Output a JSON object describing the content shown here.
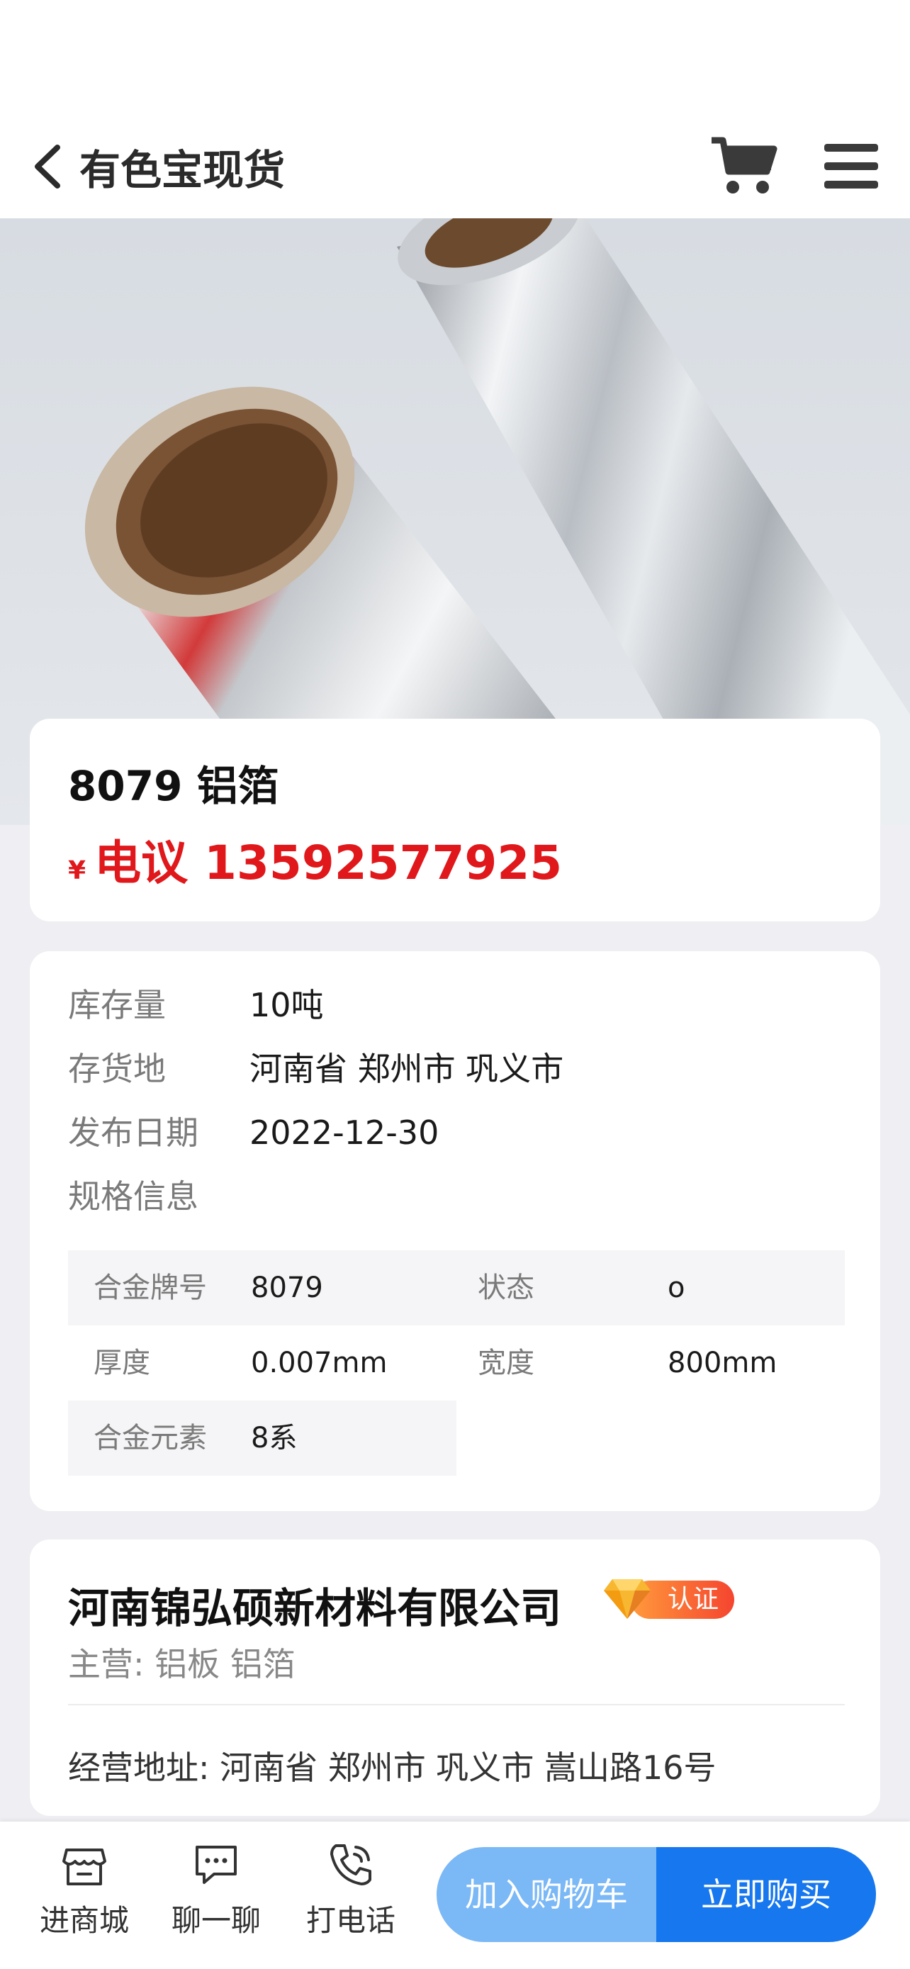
{
  "header": {
    "title": "有色宝现货",
    "back_icon": "chevron-left-icon",
    "cart_icon": "cart-icon",
    "menu_icon": "hamburger-menu-icon"
  },
  "hero": {
    "image": "aluminum-foil-rolls"
  },
  "product": {
    "name": "8079 铝箔",
    "price_symbol": "¥",
    "price_text": "电议 13592577925",
    "price_color": "#e0181b"
  },
  "info": {
    "rows": [
      {
        "label": "库存量",
        "value": "10吨"
      },
      {
        "label": "存货地",
        "value": "河南省 郑州市 巩义市"
      },
      {
        "label": "发布日期",
        "value": "2022-12-30"
      },
      {
        "label": "规格信息",
        "value": ""
      }
    ],
    "specs": [
      {
        "label": "合金牌号",
        "value": "8079"
      },
      {
        "label": "状态",
        "value": "o"
      },
      {
        "label": "厚度",
        "value": "0.007mm"
      },
      {
        "label": "宽度",
        "value": "800mm"
      },
      {
        "label": "合金元素",
        "value": "8系"
      }
    ]
  },
  "company": {
    "name": "河南锦弘硕新材料有限公司",
    "cert_label": "认证",
    "main_business": "主营: 铝板   铝箔",
    "address": "经营地址: 河南省 郑州市 巩义市 嵩山路16号"
  },
  "bottom_bar": {
    "tabs": [
      {
        "icon": "store-icon",
        "label": "进商城"
      },
      {
        "icon": "chat-icon",
        "label": "聊一聊"
      },
      {
        "icon": "phone-icon",
        "label": "打电话"
      }
    ],
    "add_to_cart_label": "加入购物车",
    "buy_now_label": "立即购买",
    "accent_color": "#1677ee",
    "accent_light_color": "#7bb8f6"
  }
}
